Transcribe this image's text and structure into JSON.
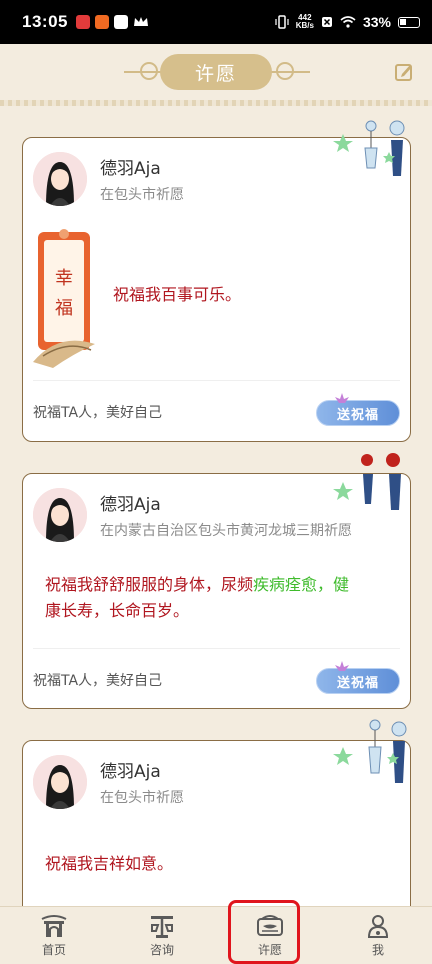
{
  "status_bar": {
    "time": "13:05",
    "net_speed_top": "442",
    "net_speed_unit": "KB/s",
    "battery": "33%"
  },
  "header": {
    "title": "许愿"
  },
  "cards": [
    {
      "user_name": "德羽Aja",
      "location": "在包头市祈愿",
      "wish_text": "祝福我百事可乐。",
      "bless_prompt": "祝福TA人，美好自己",
      "bless_button": "送祝福"
    },
    {
      "user_name": "德羽Aja",
      "location": "在内蒙古自治区包头市黄河龙城三期祈愿",
      "wish_part1": "祝福我舒舒服服的身体，尿频",
      "wish_part2": "疾病痊愈",
      "wish_part3": "，健",
      "wish_part4": "康长寿，长命百岁。",
      "bless_prompt": "祝福TA人，美好自己",
      "bless_button": "送祝福"
    },
    {
      "user_name": "德羽Aja",
      "location": "在包头市祈愿",
      "wish_text": "祝福我吉祥如意。"
    }
  ],
  "tabbar": {
    "tabs": [
      {
        "label": "首页",
        "icon": "home-gate-icon"
      },
      {
        "label": "咨询",
        "icon": "consult-icon"
      },
      {
        "label": "许愿",
        "icon": "wish-icon"
      },
      {
        "label": "我",
        "icon": "profile-icon"
      }
    ],
    "selected": "许愿"
  },
  "colors": {
    "accent": "#d6bf8c",
    "wish_red": "#b0161f",
    "highlight": "#e0151d"
  }
}
